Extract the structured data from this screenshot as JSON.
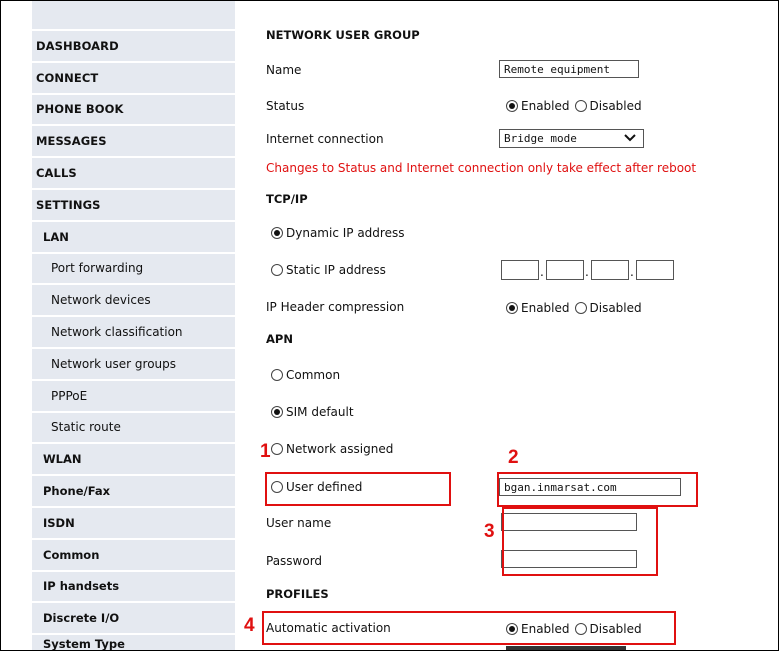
{
  "sidebar": {
    "items": [
      {
        "label": "DASHBOARD",
        "level": "top"
      },
      {
        "label": "CONNECT",
        "level": "top"
      },
      {
        "label": "PHONE BOOK",
        "level": "top"
      },
      {
        "label": "MESSAGES",
        "level": "top"
      },
      {
        "label": "CALLS",
        "level": "top"
      },
      {
        "label": "SETTINGS",
        "level": "top"
      },
      {
        "label": "LAN",
        "level": "sub"
      },
      {
        "label": "Port forwarding",
        "level": "sub2"
      },
      {
        "label": "Network devices",
        "level": "sub2"
      },
      {
        "label": "Network classification",
        "level": "sub2"
      },
      {
        "label": "Network user groups",
        "level": "sub2"
      },
      {
        "label": "PPPoE",
        "level": "sub2"
      },
      {
        "label": "Static route",
        "level": "sub2"
      },
      {
        "label": "WLAN",
        "level": "sub"
      },
      {
        "label": "Phone/Fax",
        "level": "sub"
      },
      {
        "label": "ISDN",
        "level": "sub"
      },
      {
        "label": "Common",
        "level": "sub"
      },
      {
        "label": "IP handsets",
        "level": "sub"
      },
      {
        "label": "Discrete I/O",
        "level": "sub"
      },
      {
        "label": "System Type",
        "level": "sub"
      }
    ]
  },
  "form": {
    "section_group": "NETWORK USER GROUP",
    "name_label": "Name",
    "name_value": "Remote equipment",
    "status_label": "Status",
    "enabled": "Enabled",
    "disabled": "Disabled",
    "internet_label": "Internet connection",
    "internet_value": "Bridge mode",
    "reboot_warning": "Changes to Status and Internet connection only take effect after reboot",
    "section_tcpip": "TCP/IP",
    "dynamic_ip": "Dynamic IP address",
    "static_ip": "Static IP address",
    "ip_header_label": "IP Header compression",
    "section_apn": "APN",
    "apn_common": "Common",
    "apn_sim_default": "SIM default",
    "apn_network_assigned": "Network assigned",
    "apn_user_defined": "User defined",
    "apn_value": "bgan.inmarsat.com",
    "username_label": "User name",
    "username_value": "",
    "password_label": "Password",
    "password_value": "",
    "section_profiles": "PROFILES",
    "auto_activation_label": "Automatic activation"
  },
  "annotations": {
    "n1": "1",
    "n2": "2",
    "n3": "3",
    "n4": "4",
    "color": "#e01010"
  }
}
